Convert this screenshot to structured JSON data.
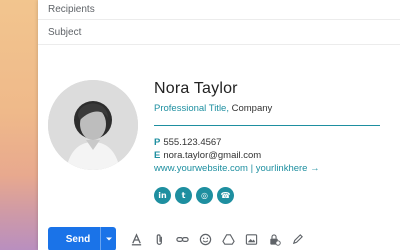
{
  "compose": {
    "recipients_placeholder": "Recipients",
    "subject_placeholder": "Subject"
  },
  "signature": {
    "name": "Nora Taylor",
    "title": "Professional Title,",
    "company": "Company",
    "phone_label": "P",
    "phone": "555.123.4567",
    "email_label": "E",
    "email": "nora.taylor@gmail.com",
    "links": "www.yourwebsite.com | yourlinkhere →",
    "social": [
      {
        "name": "linkedin-icon",
        "glyph": "in"
      },
      {
        "name": "twitter-icon",
        "glyph": "t"
      },
      {
        "name": "instagram-icon",
        "glyph": "◎"
      },
      {
        "name": "whatsapp-icon",
        "glyph": "☎"
      }
    ],
    "accent_color": "#1e8fa0"
  },
  "toolbar": {
    "send_label": "Send",
    "send_color": "#1a73e8",
    "icons": [
      "format-text-icon",
      "attach-icon",
      "link-icon",
      "emoji-icon",
      "drive-icon",
      "photo-icon",
      "lock-icon",
      "pen-icon"
    ]
  }
}
